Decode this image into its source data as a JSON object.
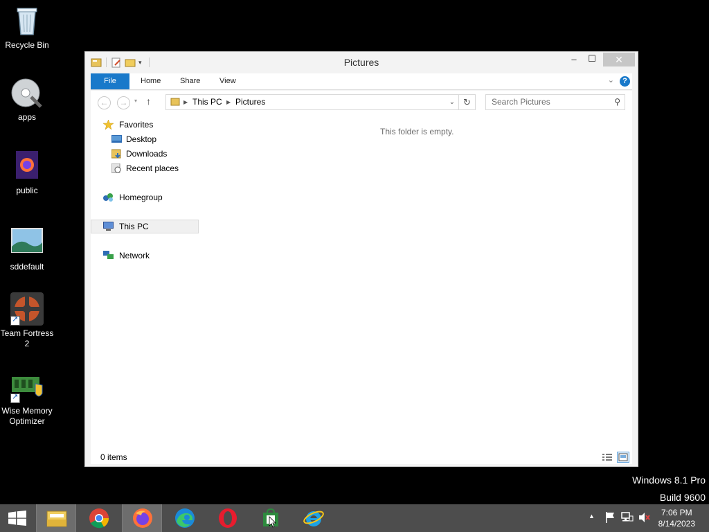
{
  "desktop": {
    "icons": [
      {
        "label": "Recycle Bin"
      },
      {
        "label": "apps"
      },
      {
        "label": "public"
      },
      {
        "label": "sddefault"
      },
      {
        "label": "Team Fortress 2"
      },
      {
        "label": "Wise Memory Optimizer"
      }
    ],
    "watermark": {
      "line1": "Windows 8.1 Pro",
      "line2": "Build 9600"
    }
  },
  "window": {
    "title": "Pictures",
    "controls": {
      "minimize": "–",
      "maximize": "☐",
      "close": "✕"
    },
    "ribbon": {
      "tabs": [
        "File",
        "Home",
        "Share",
        "View"
      ],
      "help": "?"
    },
    "address": {
      "crumbs": [
        "This PC",
        "Pictures"
      ]
    },
    "search": {
      "placeholder": "Search Pictures"
    },
    "nav": {
      "favorites": "Favorites",
      "favorites_items": [
        "Desktop",
        "Downloads",
        "Recent places"
      ],
      "homegroup": "Homegroup",
      "this_pc": "This PC",
      "network": "Network"
    },
    "empty_message": "This folder is empty.",
    "status": {
      "count": "0 items"
    }
  },
  "taskbar": {
    "clock": {
      "time": "7:06 PM",
      "date": "8/14/2023"
    }
  },
  "colors": {
    "accent": "#1979ca",
    "taskbar": "#4d4d4d",
    "desktop": "#000000"
  }
}
